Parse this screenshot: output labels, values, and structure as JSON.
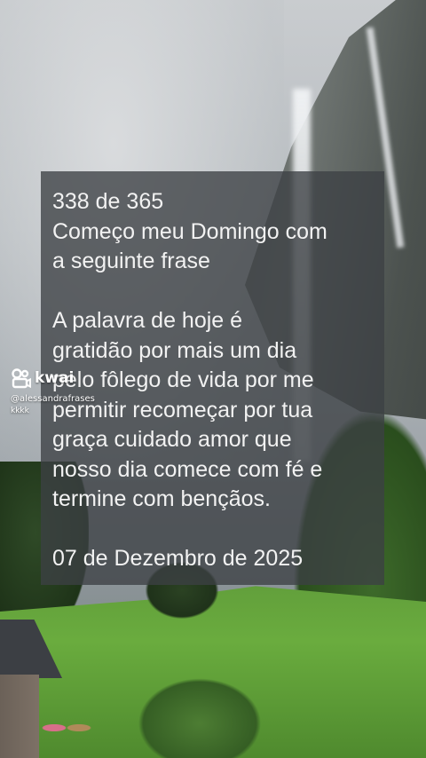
{
  "quote": {
    "line1": "338 de 365",
    "line2": "Começo meu Domingo com",
    "line3": "a seguinte frase",
    "line4": "A palavra de hoje é",
    "line5": "gratidão por mais um dia",
    "line6": "pelo fôlego de vida por me",
    "line7": "permitir recomeçar por tua",
    "line8": "graça cuidado amor que",
    "line9": "nosso dia comece com fé e",
    "line10": "termine com bençãos.",
    "date": "07 de Dezembro de 2025"
  },
  "watermark": {
    "brand": "kwai",
    "username": "@alessandrafrases",
    "extra": "kkkk",
    "logo_icon": "kwai-logo-icon"
  }
}
